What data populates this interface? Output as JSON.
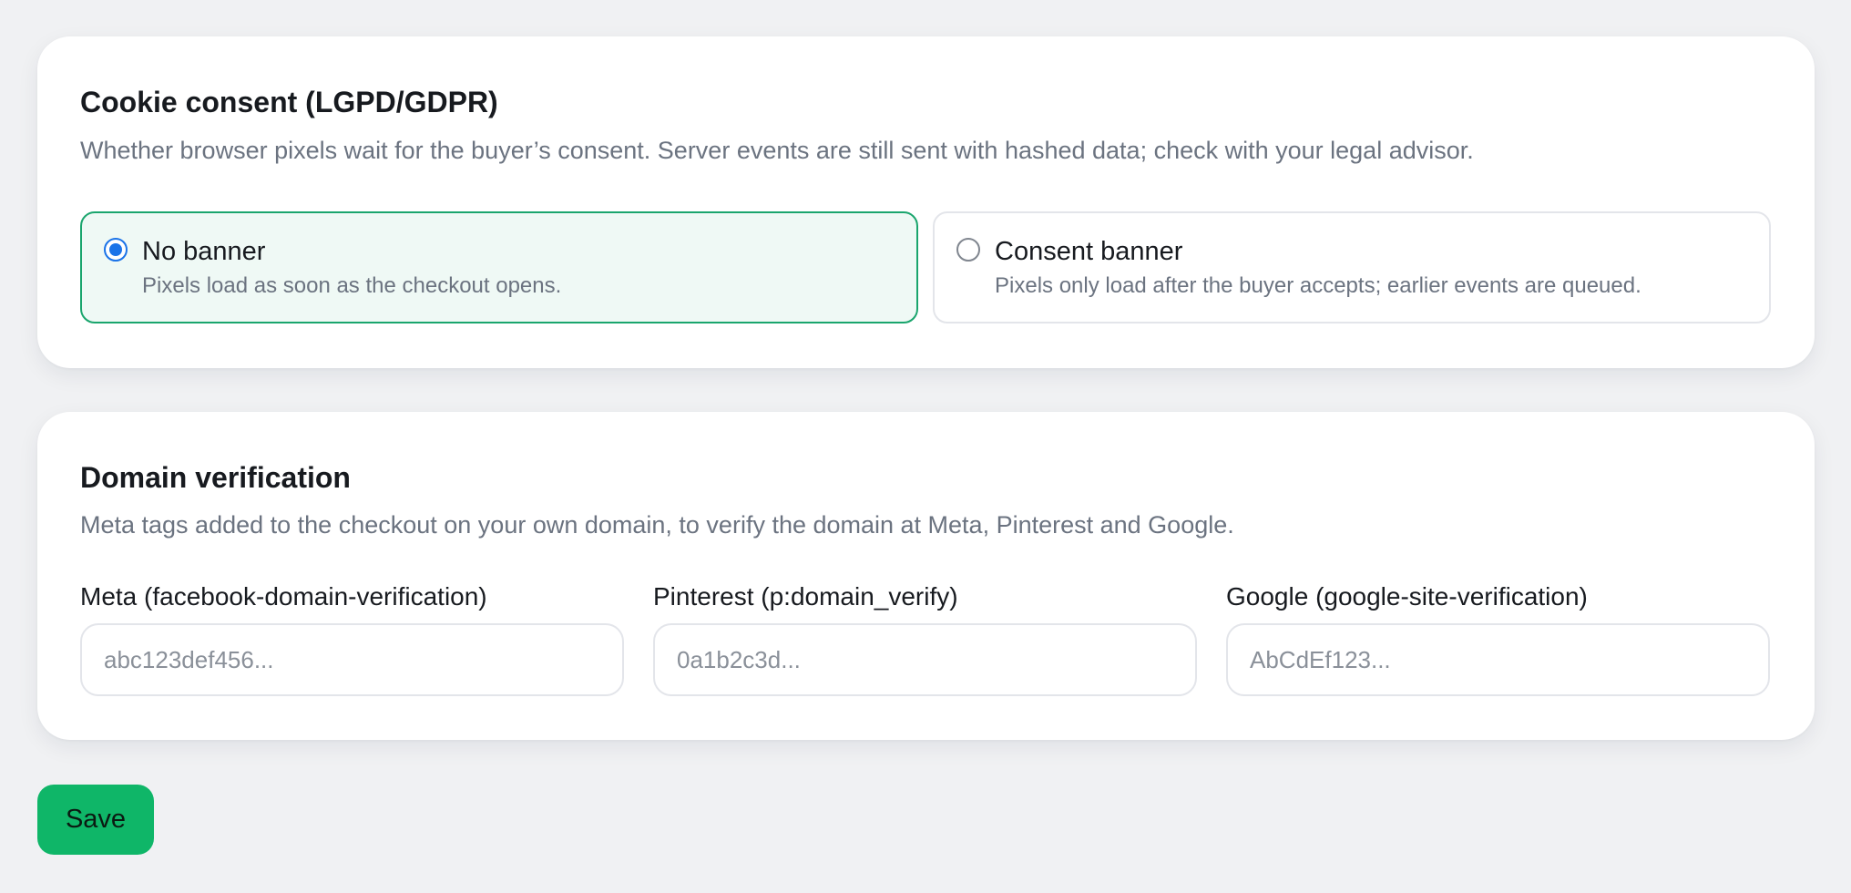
{
  "cookie_consent": {
    "title": "Cookie consent (LGPD/GDPR)",
    "description": "Whether browser pixels wait for the buyer’s consent. Server events are still sent with hashed data; check with your legal advisor.",
    "options": [
      {
        "label": "No banner",
        "help": "Pixels load as soon as the checkout opens.",
        "selected": true
      },
      {
        "label": "Consent banner",
        "help": "Pixels only load after the buyer accepts; earlier events are queued.",
        "selected": false
      }
    ]
  },
  "domain_verification": {
    "title": "Domain verification",
    "description": "Meta tags added to the checkout on your own domain, to verify the domain at Meta, Pinterest and Google.",
    "fields": [
      {
        "label": "Meta (facebook-domain-verification)",
        "value": "",
        "placeholder": "abc123def456..."
      },
      {
        "label": "Pinterest (p:domain_verify)",
        "value": "",
        "placeholder": "0a1b2c3d..."
      },
      {
        "label": "Google (google-site-verification)",
        "value": "",
        "placeholder": "AbCdEf123..."
      }
    ]
  },
  "actions": {
    "save_label": "Save"
  },
  "colors": {
    "accent_green": "#0fb668",
    "selected_border": "#1aa56d",
    "selected_background": "#eff9f5",
    "radio_blue": "#1a73e8"
  }
}
